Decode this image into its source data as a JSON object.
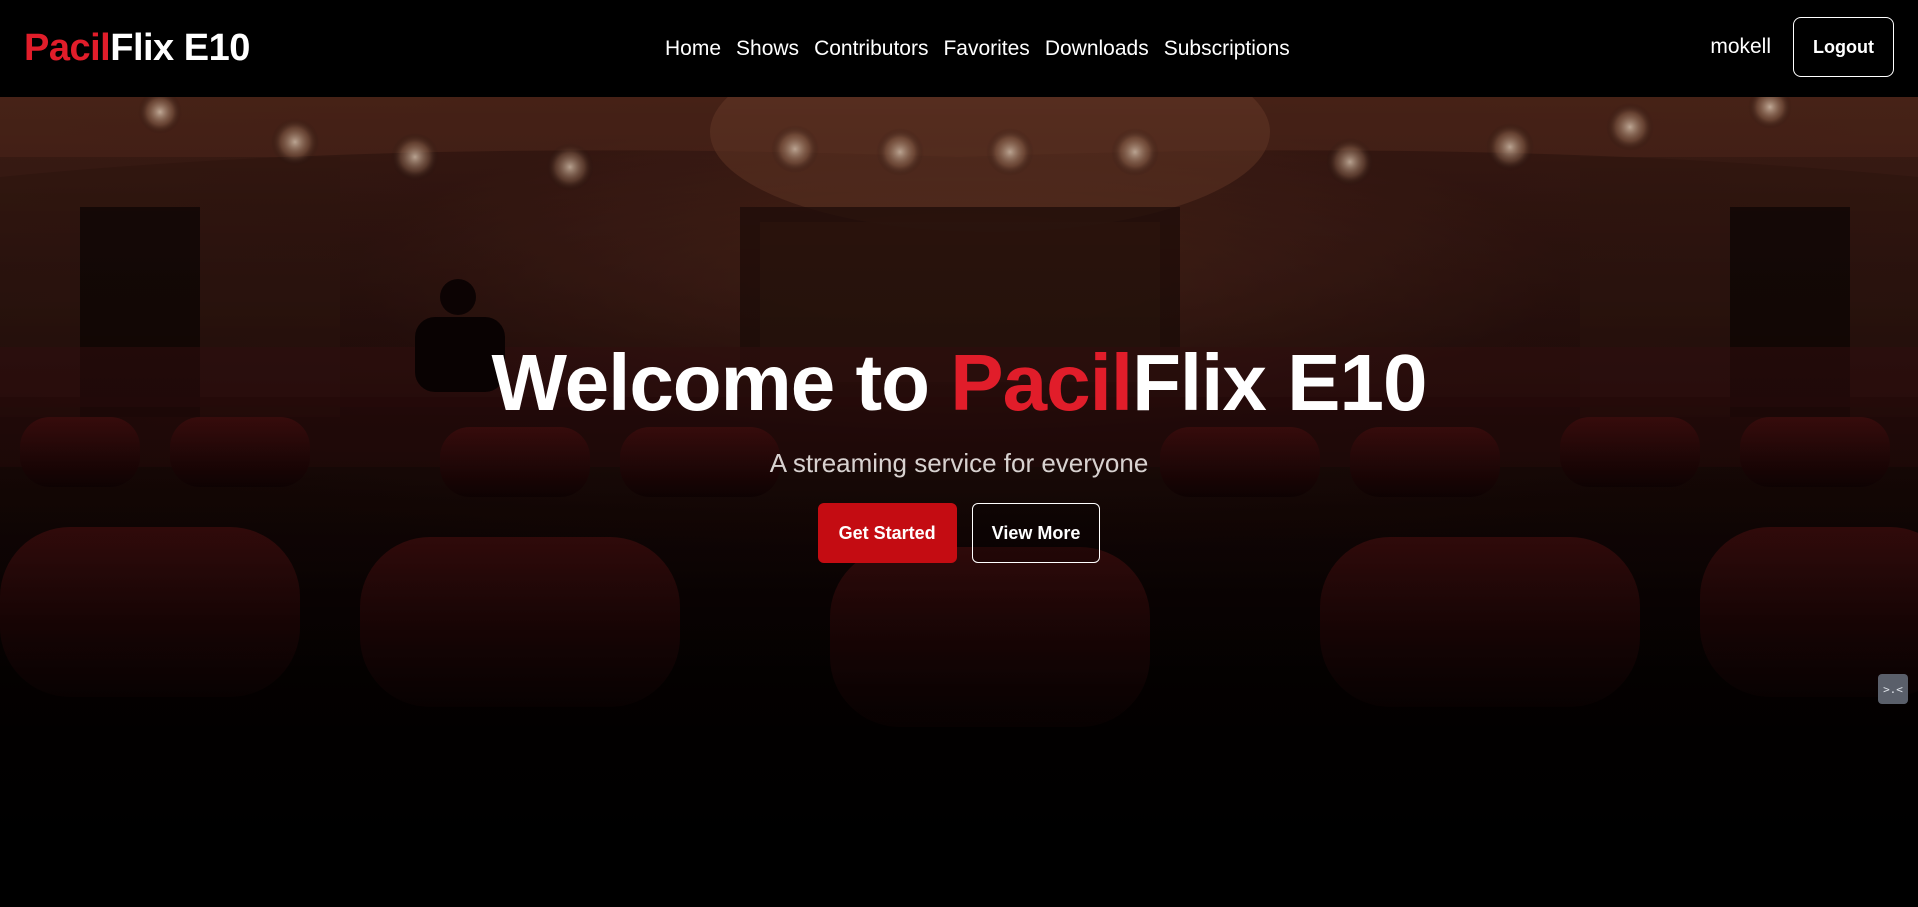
{
  "brand": {
    "accent": "Pacil",
    "rest": "Flix E10"
  },
  "nav": {
    "links": [
      "Home",
      "Shows",
      "Contributors",
      "Favorites",
      "Downloads",
      "Subscriptions"
    ],
    "username": "mokell",
    "logout_label": "Logout"
  },
  "hero": {
    "title_prefix": "Welcome to ",
    "title_accent": "Pacil",
    "title_suffix": "Flix E10",
    "subtitle": "A streaming service for everyone",
    "primary_button": "Get Started",
    "secondary_button": "View More"
  },
  "side_widget": {
    "icon": "face-icon",
    "glyph": ">.<"
  },
  "colors": {
    "accent": "#e11d2a",
    "primary_button": "#c40c12",
    "navbar": "#000000"
  }
}
